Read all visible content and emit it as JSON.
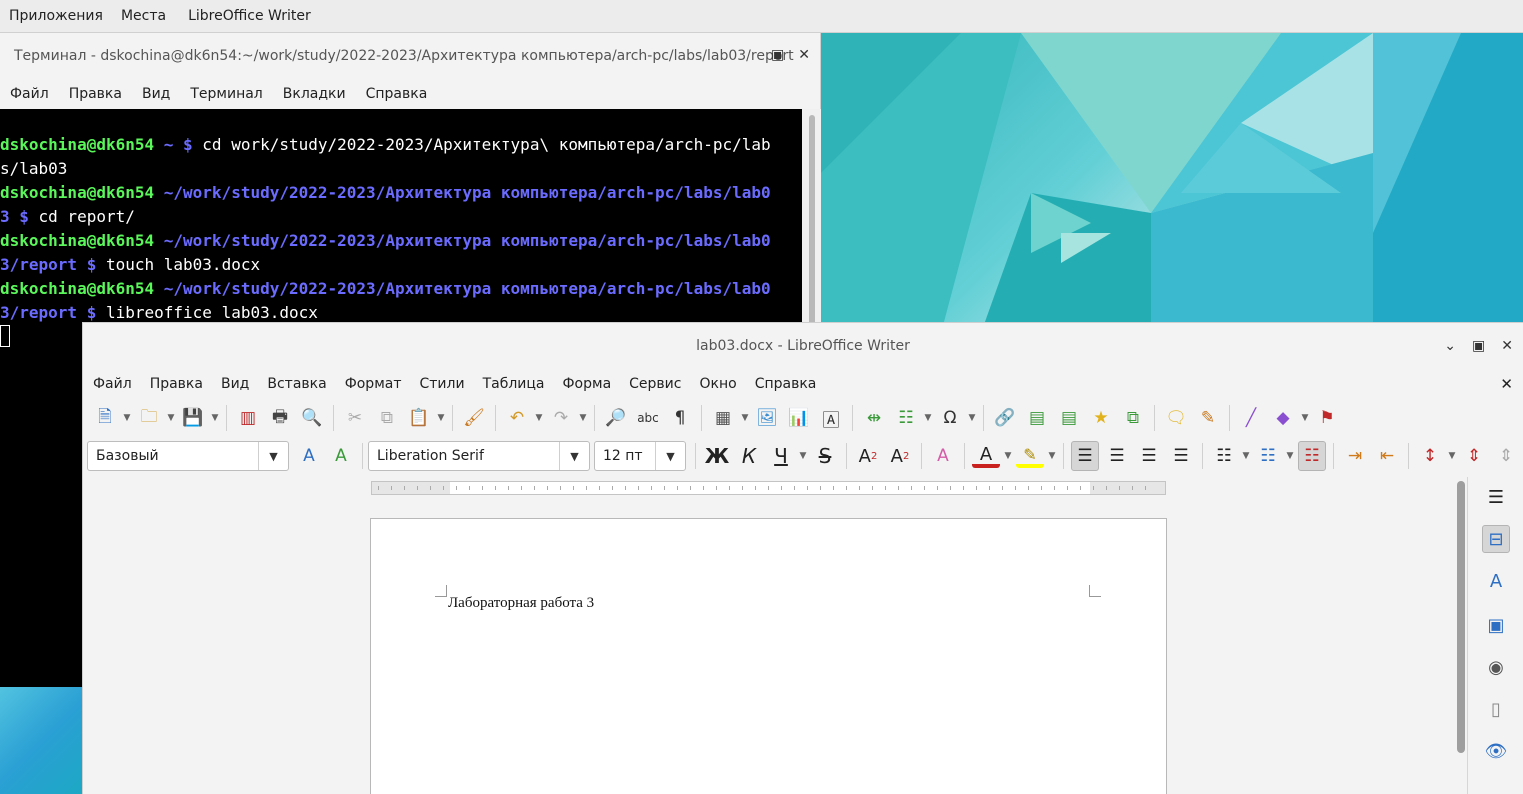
{
  "top_panel": {
    "items": [
      "Приложения",
      "Места",
      "LibreOffice Writer"
    ]
  },
  "terminal": {
    "title": "Терминал - dskochina@dk6n54:~/work/study/2022-2023/Архитектура компьютера/arch-pc/labs/lab03/report",
    "menu": [
      "Файл",
      "Правка",
      "Вид",
      "Терминал",
      "Вкладки",
      "Справка"
    ],
    "lines": [
      {
        "user": "dskochina@dk6n54",
        "path": " ~ ",
        "prompt": "$ ",
        "cmd": "cd work/study/2022-2023/Архитектура\\ компьютера/arch-pc/lab"
      },
      {
        "user": "",
        "path": "",
        "prompt": "",
        "cmd": "s/lab03"
      },
      {
        "user": "dskochina@dk6n54",
        "path": " ~/work/study/2022-2023/Архитектура компьютера/arch-pc/labs/lab0",
        "prompt": "",
        "cmd": ""
      },
      {
        "user": "",
        "path": "3 ",
        "prompt": "$ ",
        "cmd": "cd report/"
      },
      {
        "user": "dskochina@dk6n54",
        "path": " ~/work/study/2022-2023/Архитектура компьютера/arch-pc/labs/lab0",
        "prompt": "",
        "cmd": ""
      },
      {
        "user": "",
        "path": "3/report ",
        "prompt": "$ ",
        "cmd": "touch lab03.docx"
      },
      {
        "user": "dskochina@dk6n54",
        "path": " ~/work/study/2022-2023/Архитектура компьютера/arch-pc/labs/lab0",
        "prompt": "",
        "cmd": ""
      },
      {
        "user": "",
        "path": "3/report ",
        "prompt": "$ ",
        "cmd": "libreoffice lab03.docx"
      }
    ]
  },
  "writer": {
    "title": "lab03.docx - LibreOffice Writer",
    "menu": [
      "Файл",
      "Правка",
      "Вид",
      "Вставка",
      "Формат",
      "Стили",
      "Таблица",
      "Форма",
      "Сервис",
      "Окно",
      "Справка"
    ],
    "paragraph_style": "Базовый",
    "font_name": "Liberation Serif",
    "font_size": "12 пт",
    "bold_label": "Ж",
    "italic_label": "К",
    "underline_label": "Ч",
    "strike_label": "S",
    "document_text": "Лабораторная работа 3",
    "colors": {
      "font_color": "#c9211e",
      "highlight": "#ffff00"
    }
  }
}
